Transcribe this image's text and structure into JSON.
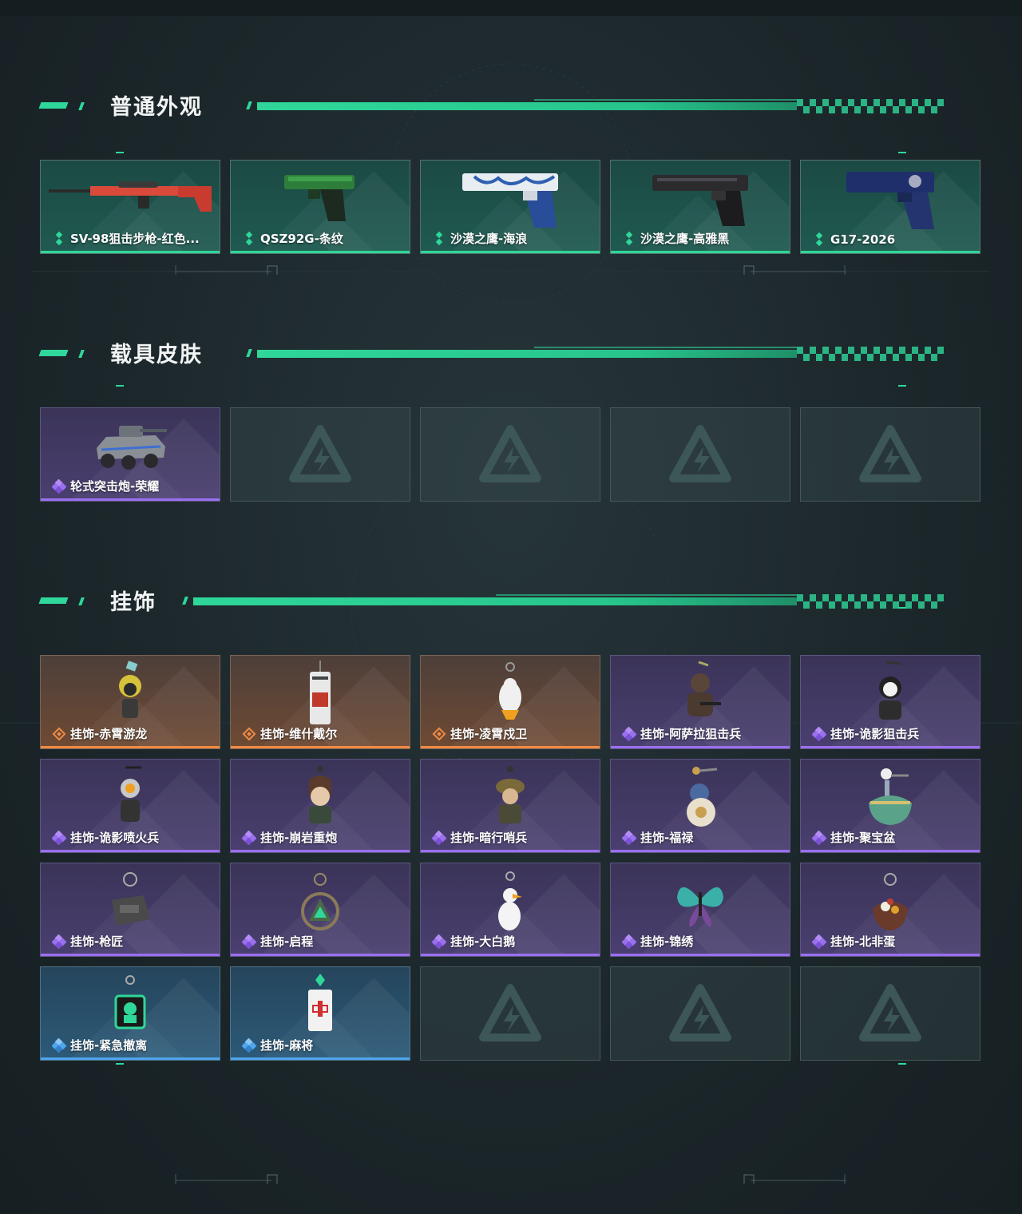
{
  "sections": {
    "weapon_skins": {
      "title": "普通外观",
      "items": [
        {
          "label": "SV-98狙击步枪-红色...",
          "rarity": "green",
          "icon": "sniper-rifle-icon"
        },
        {
          "label": "QSZ92G-条纹",
          "rarity": "green",
          "icon": "pistol-icon"
        },
        {
          "label": "沙漠之鹰-海浪",
          "rarity": "green",
          "icon": "pistol-icon"
        },
        {
          "label": "沙漠之鹰-高雅黑",
          "rarity": "green",
          "icon": "pistol-icon"
        },
        {
          "label": "G17-2026",
          "rarity": "green",
          "icon": "pistol-icon"
        }
      ]
    },
    "vehicle_skins": {
      "title": "载具皮肤",
      "items": [
        {
          "label": "轮式突击炮-荣耀",
          "rarity": "purple",
          "icon": "armored-vehicle-icon"
        }
      ]
    },
    "charms": {
      "title": "挂饰",
      "items": [
        {
          "label": "挂饰-赤霄游龙",
          "rarity": "orange",
          "icon": "charm-icon"
        },
        {
          "label": "挂饰-维什戴尔",
          "rarity": "orange",
          "icon": "charm-icon"
        },
        {
          "label": "挂饰-凌霄戍卫",
          "rarity": "orange",
          "icon": "charm-icon"
        },
        {
          "label": "挂饰-阿萨拉狙击兵",
          "rarity": "purple",
          "icon": "charm-icon"
        },
        {
          "label": "挂饰-诡影狙击兵",
          "rarity": "purple",
          "icon": "charm-icon"
        },
        {
          "label": "挂饰-诡影喷火兵",
          "rarity": "purple",
          "icon": "charm-icon"
        },
        {
          "label": "挂饰-崩岩重炮",
          "rarity": "purple",
          "icon": "charm-icon"
        },
        {
          "label": "挂饰-暗行哨兵",
          "rarity": "purple",
          "icon": "charm-icon"
        },
        {
          "label": "挂饰-福禄",
          "rarity": "purple",
          "icon": "charm-icon"
        },
        {
          "label": "挂饰-聚宝盆",
          "rarity": "purple",
          "icon": "charm-icon"
        },
        {
          "label": "挂饰-枪匠",
          "rarity": "purple",
          "icon": "charm-icon"
        },
        {
          "label": "挂饰-启程",
          "rarity": "purple",
          "icon": "charm-icon"
        },
        {
          "label": "挂饰-大白鹅",
          "rarity": "purple",
          "icon": "charm-icon"
        },
        {
          "label": "挂饰-锦绣",
          "rarity": "purple",
          "icon": "charm-icon"
        },
        {
          "label": "挂饰-北非蛋",
          "rarity": "purple",
          "icon": "charm-icon"
        },
        {
          "label": "挂饰-紧急撤离",
          "rarity": "blue",
          "icon": "charm-icon"
        },
        {
          "label": "挂饰-麻将",
          "rarity": "blue",
          "icon": "charm-icon"
        }
      ]
    }
  },
  "colors": {
    "accent": "#2fd79a",
    "rarity_green": "#2fd79a",
    "rarity_purple": "#9a6ff0",
    "rarity_orange": "#f08a44",
    "rarity_blue": "#4ea6ee"
  }
}
